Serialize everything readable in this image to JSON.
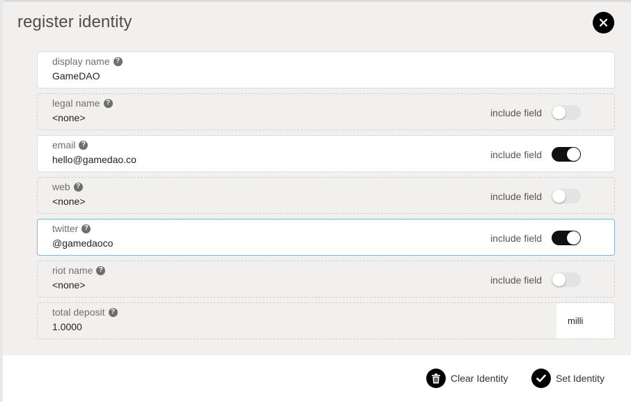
{
  "modal": {
    "title": "register identity"
  },
  "fields": [
    {
      "label": "display name",
      "value": "GameDAO"
    },
    {
      "label": "legal name",
      "value": "<none>",
      "include_label": "include field",
      "included": false
    },
    {
      "label": "email",
      "value": "hello@gamedao.co",
      "include_label": "include field",
      "included": true
    },
    {
      "label": "web",
      "value": "<none>",
      "include_label": "include field",
      "included": false
    },
    {
      "label": "twitter",
      "value": "@gamedaoco",
      "include_label": "include field",
      "included": true
    },
    {
      "label": "riot name",
      "value": "<none>",
      "include_label": "include field",
      "included": false
    },
    {
      "label": "total deposit",
      "value": "1.0000",
      "unit": "milli"
    }
  ],
  "footer": {
    "clear_label": "Clear Identity",
    "set_label": "Set Identity"
  },
  "icons": {
    "close": "close-icon",
    "help": "help-icon",
    "trash": "trash-icon",
    "check": "check-icon"
  },
  "colors": {
    "accent": "#000000",
    "focus_border": "#85b7d9"
  }
}
